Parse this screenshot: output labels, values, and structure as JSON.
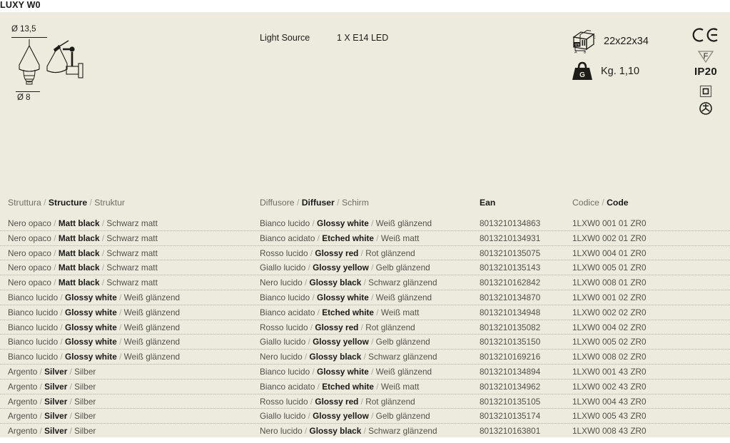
{
  "product": {
    "title": "LUXY W0"
  },
  "dimensions": {
    "top_label": "Ø 13,5",
    "bottom_label": "Ø 8",
    "pendant_icon": "pendant-lamp-drawing",
    "wall_icon": "wall-lamp-drawing"
  },
  "light_source": {
    "label": "Light Source",
    "value": "1 X E14 LED"
  },
  "packaging": {
    "box_icon": "carton-box-icon",
    "box_icon_unit": "cm",
    "box_icon_labels": [
      "A",
      "B",
      "C"
    ],
    "dimensions": "22x22x34",
    "weight_icon": "weight-icon",
    "weight_icon_letter": "G",
    "weight": "Kg. 1,10"
  },
  "certifications": [
    {
      "name": "ce-mark-icon",
      "label": "CE"
    },
    {
      "name": "f-mark-icon",
      "label": "F"
    },
    {
      "name": "ip-rating",
      "label": "IP20"
    },
    {
      "name": "class-2-double-insulation-icon",
      "label": ""
    },
    {
      "name": "enec-mark-icon",
      "label": ""
    }
  ],
  "table": {
    "headers": {
      "structure": {
        "it": "Struttura",
        "en": "Structure",
        "de": "Struktur"
      },
      "diffuser": {
        "it": "Diffusore",
        "en": "Diffuser",
        "de": "Schirm"
      },
      "ean": {
        "en": "Ean"
      },
      "code": {
        "it": "Codice",
        "en": "Code"
      }
    },
    "rows": [
      {
        "structure": {
          "it": "Nero opaco",
          "en": "Matt black",
          "de": "Schwarz matt"
        },
        "diffuser": {
          "it": "Bianco lucido",
          "en": "Glossy white",
          "de": "Weiß glänzend"
        },
        "ean": "8013210134863",
        "code": "1LXW0 001 01 ZR0"
      },
      {
        "structure": {
          "it": "Nero opaco",
          "en": "Matt black",
          "de": "Schwarz matt"
        },
        "diffuser": {
          "it": "Bianco acidato",
          "en": "Etched white",
          "de": "Weiß matt"
        },
        "ean": "8013210134931",
        "code": "1LXW0 002 01 ZR0"
      },
      {
        "structure": {
          "it": "Nero opaco",
          "en": "Matt black",
          "de": "Schwarz matt"
        },
        "diffuser": {
          "it": "Rosso lucido",
          "en": "Glossy red",
          "de": "Rot glänzend"
        },
        "ean": "8013210135075",
        "code": "1LXW0 004 01 ZR0"
      },
      {
        "structure": {
          "it": "Nero opaco",
          "en": "Matt black",
          "de": "Schwarz matt"
        },
        "diffuser": {
          "it": "Giallo lucido",
          "en": "Glossy yellow",
          "de": "Gelb glänzend"
        },
        "ean": "8013210135143",
        "code": "1LXW0 005 01 ZR0"
      },
      {
        "structure": {
          "it": "Nero opaco",
          "en": "Matt black",
          "de": "Schwarz matt"
        },
        "diffuser": {
          "it": "Nero lucido",
          "en": "Glossy black",
          "de": "Schwarz glänzend"
        },
        "ean": "8013210162842",
        "code": "1LXW0 008 01 ZR0"
      },
      {
        "structure": {
          "it": "Bianco lucido",
          "en": "Glossy white",
          "de": "Weiß glänzend"
        },
        "diffuser": {
          "it": "Bianco lucido",
          "en": "Glossy white",
          "de": "Weiß glänzend"
        },
        "ean": "8013210134870",
        "code": "1LXW0 001 02 ZR0"
      },
      {
        "structure": {
          "it": "Bianco lucido",
          "en": "Glossy white",
          "de": "Weiß glänzend"
        },
        "diffuser": {
          "it": "Bianco acidato",
          "en": "Etched white",
          "de": "Weiß matt"
        },
        "ean": "8013210134948",
        "code": "1LXW0 002 02 ZR0"
      },
      {
        "structure": {
          "it": "Bianco lucido",
          "en": "Glossy white",
          "de": "Weiß glänzend"
        },
        "diffuser": {
          "it": "Rosso lucido",
          "en": "Glossy red",
          "de": "Rot glänzend"
        },
        "ean": "8013210135082",
        "code": "1LXW0 004 02 ZR0"
      },
      {
        "structure": {
          "it": "Bianco lucido",
          "en": "Glossy white",
          "de": "Weiß glänzend"
        },
        "diffuser": {
          "it": "Giallo lucido",
          "en": "Glossy yellow",
          "de": "Gelb glänzend"
        },
        "ean": "8013210135150",
        "code": "1LXW0 005 02 ZR0"
      },
      {
        "structure": {
          "it": "Bianco lucido",
          "en": "Glossy white",
          "de": "Weiß glänzend"
        },
        "diffuser": {
          "it": "Nero lucido",
          "en": "Glossy black",
          "de": "Schwarz glänzend"
        },
        "ean": "8013210169216",
        "code": "1LXW0 008 02 ZR0"
      },
      {
        "structure": {
          "it": "Argento",
          "en": "Silver",
          "de": "Silber"
        },
        "diffuser": {
          "it": "Bianco lucido",
          "en": "Glossy white",
          "de": "Weiß glänzend"
        },
        "ean": "8013210134894",
        "code": "1LXW0 001 43 ZR0"
      },
      {
        "structure": {
          "it": "Argento",
          "en": "Silver",
          "de": "Silber"
        },
        "diffuser": {
          "it": "Bianco acidato",
          "en": "Etched white",
          "de": "Weiß matt"
        },
        "ean": "8013210134962",
        "code": "1LXW0 002 43 ZR0"
      },
      {
        "structure": {
          "it": "Argento",
          "en": "Silver",
          "de": "Silber"
        },
        "diffuser": {
          "it": "Rosso lucido",
          "en": "Glossy red",
          "de": "Rot glänzend"
        },
        "ean": "8013210135105",
        "code": "1LXW0 004 43 ZR0"
      },
      {
        "structure": {
          "it": "Argento",
          "en": "Silver",
          "de": "Silber"
        },
        "diffuser": {
          "it": "Giallo lucido",
          "en": "Glossy yellow",
          "de": "Gelb glänzend"
        },
        "ean": "8013210135174",
        "code": "1LXW0 005 43 ZR0"
      },
      {
        "structure": {
          "it": "Argento",
          "en": "Silver",
          "de": "Silber"
        },
        "diffuser": {
          "it": "Nero lucido",
          "en": "Glossy black",
          "de": "Schwarz glänzend"
        },
        "ean": "8013210163801",
        "code": "1LXW0 008 43 ZR0"
      }
    ]
  },
  "colors": {
    "background": "#edeade",
    "text": "#1b1a18",
    "muted": "#6f6c63",
    "rule": "#b4b1a4"
  }
}
